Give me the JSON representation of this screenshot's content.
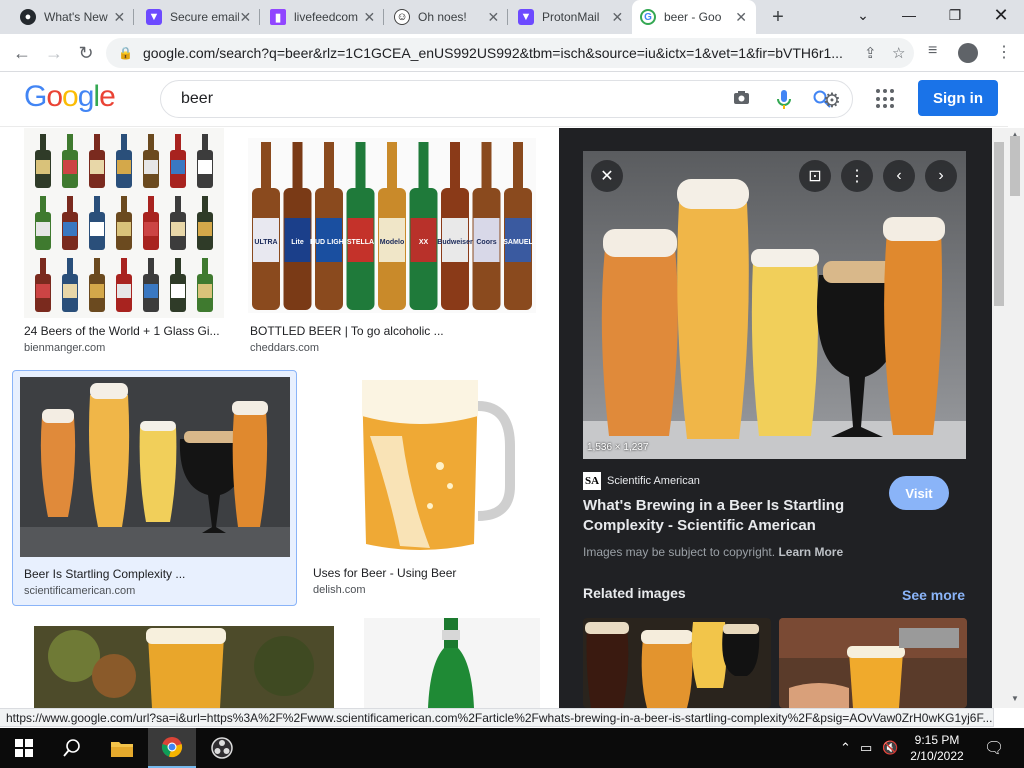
{
  "browser": {
    "tabs": [
      {
        "title": "What's New",
        "favicon": "github-icon",
        "active": false
      },
      {
        "title": "Secure email",
        "favicon": "shield-icon",
        "active": false
      },
      {
        "title": "livefeedcom",
        "favicon": "twitch-icon",
        "active": false
      },
      {
        "title": "Oh noes!",
        "favicon": "octocat-icon",
        "active": false
      },
      {
        "title": "ProtonMail",
        "favicon": "protonmail-icon",
        "active": false
      },
      {
        "title": "beer - Goo",
        "favicon": "google-icon",
        "active": true
      }
    ],
    "url": "google.com/search?q=beer&rlz=1C1GCEA_enUS992US992&tbm=isch&source=iu&ictx=1&vet=1&fir=bVTH6r1..."
  },
  "google": {
    "logo_letters": [
      "G",
      "o",
      "o",
      "g",
      "l",
      "e"
    ],
    "logo_colors": [
      "#4285F4",
      "#EA4335",
      "#FBBC05",
      "#4285F4",
      "#34A853",
      "#EA4335"
    ],
    "search_query": "beer",
    "signin_label": "Sign in"
  },
  "results": [
    {
      "caption": "24 Beers of the World + 1 Glass Gi...",
      "source": "bienmanger.com"
    },
    {
      "caption": "BOTTLED BEER | To go alcoholic ...",
      "source": "cheddars.com"
    },
    {
      "caption": "Beer Is Startling Complexity ...",
      "source": "scientificamerican.com",
      "selected": true
    },
    {
      "caption": "Uses for Beer - Using Beer",
      "source": "delish.com"
    },
    {
      "caption": "",
      "source": ""
    },
    {
      "caption": "",
      "source": ""
    }
  ],
  "bottle_labels": [
    "ULTRA",
    "Lite",
    "BUD LIGHT",
    "STELLA",
    "Modelo",
    "XX",
    "Budweiser",
    "Coors",
    "SAMUEL"
  ],
  "panel": {
    "dimensions": "1,536 × 1,237",
    "source_logo": "SA",
    "source_name": "Scientific American",
    "title": "What's Brewing in a Beer Is Startling Complexity - Scientific American",
    "visit_label": "Visit",
    "copyright_text": "Images may be subject to copyright.",
    "learn_more": "Learn More",
    "related_label": "Related images",
    "see_more": "See more"
  },
  "status_url": "https://www.google.com/url?sa=i&url=https%3A%2F%2Fwww.scientificamerican.com%2Farticle%2Fwhats-brewing-in-a-beer-is-startling-complexity%2F&psig=AOvVaw0ZrH0wKG1yj6F...",
  "taskbar": {
    "time": "9:15 PM",
    "date": "2/10/2022"
  },
  "colors": {
    "google_blue": "#1a73e8",
    "panel_bg": "#202124",
    "visit_blue": "#8ab4f8",
    "beer_amber": "#e8a534",
    "stout": "#1a1a1a"
  }
}
